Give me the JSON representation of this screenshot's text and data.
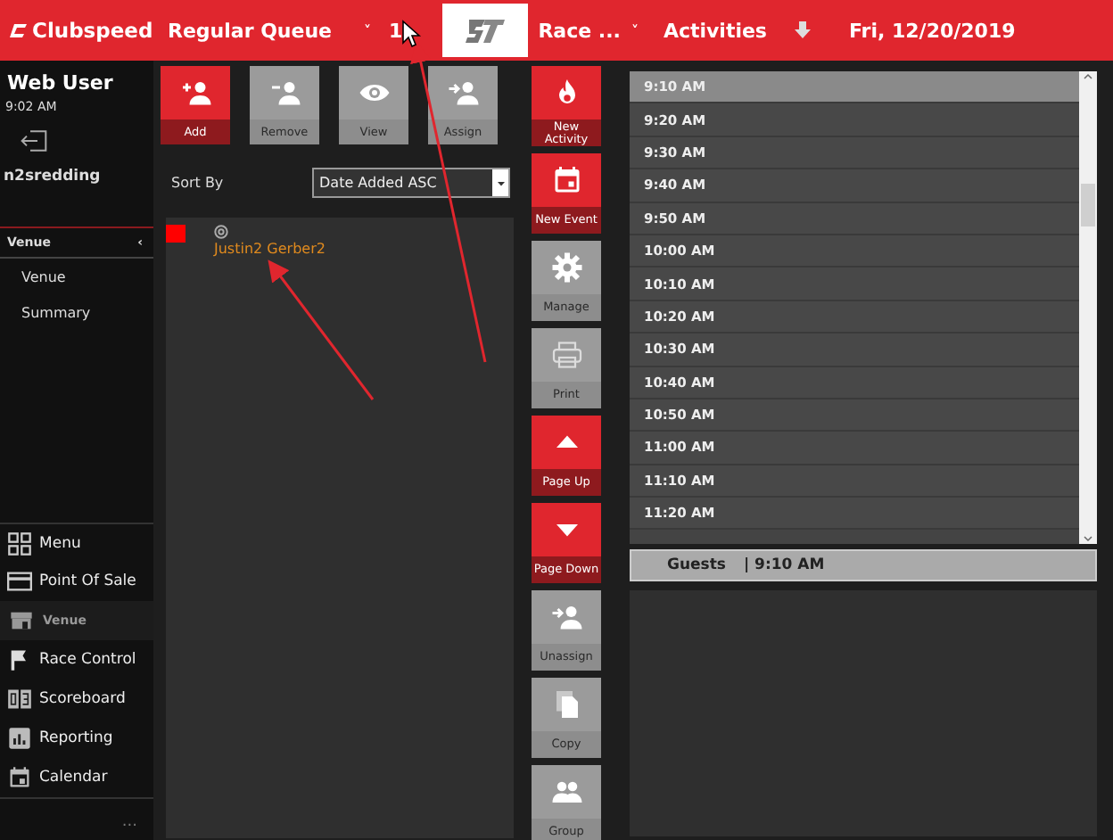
{
  "header": {
    "brand": "Clubspeed",
    "queue": "Regular Queue",
    "queue_caret": "˅",
    "queue_count": "1",
    "race": "Race ...",
    "race_caret": "˅",
    "activities": "Activities",
    "date": "Fri, 12/20/2019"
  },
  "user": {
    "name": "Web User",
    "time": "9:02 AM",
    "account": "n2sredding"
  },
  "venue_menu": {
    "title": "Venue",
    "collapse": "‹",
    "items": [
      {
        "label": "Venue"
      },
      {
        "label": "Summary"
      }
    ]
  },
  "nav": [
    {
      "label": "Menu",
      "selected": false
    },
    {
      "label": "Point Of Sale",
      "selected": false
    },
    {
      "label": "Venue",
      "selected": true
    },
    {
      "label": "Race Control",
      "selected": false
    },
    {
      "label": "Scoreboard",
      "selected": false
    },
    {
      "label": "Reporting",
      "selected": false
    },
    {
      "label": "Calendar",
      "selected": false
    }
  ],
  "more": "...",
  "queue_tools": [
    {
      "label": "Add",
      "kind": "primary"
    },
    {
      "label": "Remove",
      "kind": "secondary"
    },
    {
      "label": "View",
      "kind": "secondary"
    },
    {
      "label": "Assign",
      "kind": "secondary"
    }
  ],
  "sort": {
    "label": "Sort By",
    "value": "Date Added ASC"
  },
  "queue_entries": [
    {
      "name": "Justin2 Gerber2",
      "color": "#ff0000"
    }
  ],
  "actions": [
    {
      "label": "New Activity",
      "kind": "primary"
    },
    {
      "label": "New Event",
      "kind": "primary"
    },
    {
      "label": "Manage",
      "kind": "secondary"
    },
    {
      "label": "Print",
      "kind": "secondary"
    },
    {
      "label": "Page Up",
      "kind": "primary"
    },
    {
      "label": "Page Down",
      "kind": "primary"
    },
    {
      "label": "Unassign",
      "kind": "secondary"
    },
    {
      "label": "Copy",
      "kind": "secondary"
    },
    {
      "label": "Group",
      "kind": "secondary"
    }
  ],
  "times": [
    {
      "label": "9:10 AM",
      "selected": true
    },
    {
      "label": "9:20 AM",
      "selected": false
    },
    {
      "label": "9:30 AM",
      "selected": false
    },
    {
      "label": "9:40 AM",
      "selected": false
    },
    {
      "label": "9:50 AM",
      "selected": false
    },
    {
      "label": "10:00 AM",
      "selected": false
    },
    {
      "label": "10:10 AM",
      "selected": false
    },
    {
      "label": "10:20 AM",
      "selected": false
    },
    {
      "label": "10:30 AM",
      "selected": false
    },
    {
      "label": "10:40 AM",
      "selected": false
    },
    {
      "label": "10:50 AM",
      "selected": false
    },
    {
      "label": "11:00 AM",
      "selected": false
    },
    {
      "label": "11:10 AM",
      "selected": false
    },
    {
      "label": "11:20 AM",
      "selected": false
    }
  ],
  "guests": {
    "label": "Guests",
    "time": "| 9:10 AM"
  }
}
